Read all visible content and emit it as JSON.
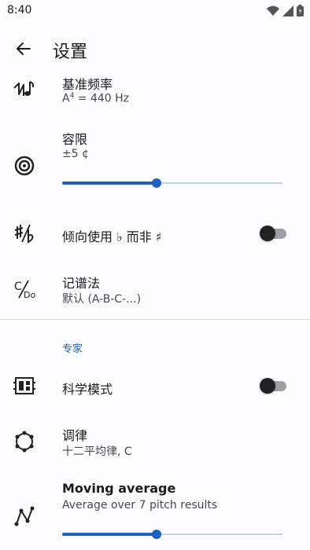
{
  "status_bar": {
    "time": "8:40",
    "icons": [
      "wifi-icon",
      "signal-icon",
      "battery-icon"
    ]
  },
  "appbar": {
    "title": "设置",
    "back_icon": "arrow-back-icon"
  },
  "settings": {
    "reference_frequency": {
      "title": "基准频率",
      "value_prefix": "A",
      "value_superscript": "4",
      "value_suffix": " = 440 Hz",
      "icon": "tuning-fork-note-icon"
    },
    "tolerance": {
      "title": "容限",
      "value": "±5 ¢",
      "icon": "target-icon",
      "slider_fraction": 0.43
    },
    "prefer_flat": {
      "title": "倾向使用 ♭ 而非 ♯",
      "icon": "sharp-flat-icon",
      "toggle_on": false
    },
    "notation": {
      "title": "记谱法",
      "value": "默认 (A-B-C-...)",
      "icon": "notation-icon"
    },
    "expert_section": {
      "title": "专家",
      "color": "#1f5fbf"
    },
    "scientific_mode": {
      "title": "科学模式",
      "icon": "dashboard-icon",
      "toggle_on": false
    },
    "temperament": {
      "title": "调律",
      "value": "十二平均律, C",
      "icon": "circle-of-dots-icon"
    },
    "moving_average": {
      "title": "Moving average",
      "value": "Average over 7 pitch results",
      "icon": "line-chart-icon",
      "slider_fraction": 0.43
    }
  },
  "colors": {
    "accent": "#1f5fbf",
    "background": "#fdfcff"
  }
}
